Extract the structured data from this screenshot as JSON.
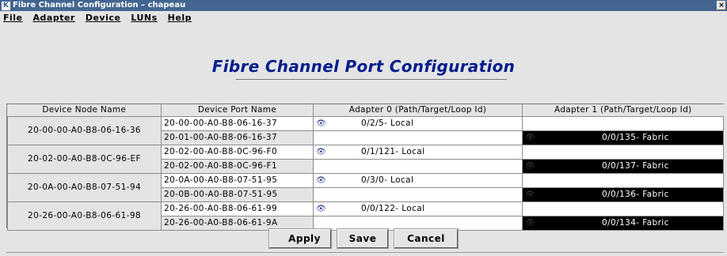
{
  "window": {
    "title": "Fibre Channel Configuration – chapeau",
    "app_icon": "K",
    "close_icon": "×"
  },
  "menu": [
    {
      "label": "File"
    },
    {
      "label": "Adapter"
    },
    {
      "label": "Device"
    },
    {
      "label": "LUNs"
    },
    {
      "label": "Help"
    }
  ],
  "heading": "Fibre Channel Port Configuration",
  "table": {
    "headers": [
      "Device Node Name",
      "Device Port Name",
      "Adapter 0 (Path/Target/Loop Id)",
      "Adapter 1 (Path/Target/Loop Id)"
    ],
    "groups": [
      {
        "node": "20-00-00-A0-B8-06-16-36",
        "rows": [
          {
            "port": "20-00-00-A0-B8-06-16-37",
            "adapter0": "0/2/5- Local",
            "adapter1": ""
          },
          {
            "port": "20-01-00-A0-B8-06-16-37",
            "adapter0": "",
            "adapter1": "0/0/135- Fabric"
          }
        ]
      },
      {
        "node": "20-02-00-A0-B8-0C-96-EF",
        "rows": [
          {
            "port": "20-02-00-A0-B8-0C-96-F0",
            "adapter0": "0/1/121- Local",
            "adapter1": ""
          },
          {
            "port": "20-02-00-A0-B8-0C-96-F1",
            "adapter0": "",
            "adapter1": "0/0/137- Fabric"
          }
        ]
      },
      {
        "node": "20-0A-00-A0-B8-07-51-94",
        "rows": [
          {
            "port": "20-0A-00-A0-B8-07-51-95",
            "adapter0": "0/3/0- Local",
            "adapter1": ""
          },
          {
            "port": "20-0B-00-A0-B8-07-51-95",
            "adapter0": "",
            "adapter1": "0/0/136- Fabric"
          }
        ]
      },
      {
        "node": "20-26-00-A0-B8-06-61-98",
        "rows": [
          {
            "port": "20-26-00-A0-B8-06-61-99",
            "adapter0": "0/0/122- Local",
            "adapter1": ""
          },
          {
            "port": "20-26-00-A0-B8-06-61-9A",
            "adapter0": "",
            "adapter1": "0/0/134- Fabric"
          }
        ]
      }
    ]
  },
  "buttons": {
    "apply": "Apply",
    "save": "Save",
    "cancel": "Cancel"
  },
  "colors": {
    "titlebar": "#3c5f8c",
    "heading": "#001c8c",
    "fabric_bg": "#000000"
  }
}
